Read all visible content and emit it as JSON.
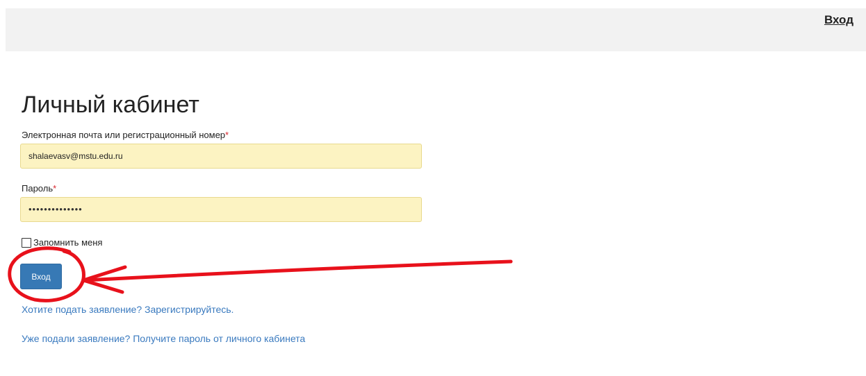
{
  "header": {
    "login_link": "Вход"
  },
  "main": {
    "title": "Личный кабинет",
    "email_field": {
      "label": "Электронная почта или регистрационный номер",
      "required_mark": "*",
      "value": "shalaevasv@mstu.edu.ru"
    },
    "password_field": {
      "label": "Пароль",
      "required_mark": "*",
      "masked_value": "••••••••••••••"
    },
    "remember_me": {
      "label": "Запомнить меня",
      "checked": false
    },
    "submit_label": "Вход",
    "register_link": "Хотите подать заявление? Зарегистрируйтесь.",
    "password_link": "Уже подали заявление? Получите пароль от личного кабинета"
  },
  "colors": {
    "accent": "#3779b5",
    "link": "#3a7abf",
    "input_background": "#fcf3c2",
    "required_star": "#d9272e",
    "annotation": "#e8111b"
  }
}
